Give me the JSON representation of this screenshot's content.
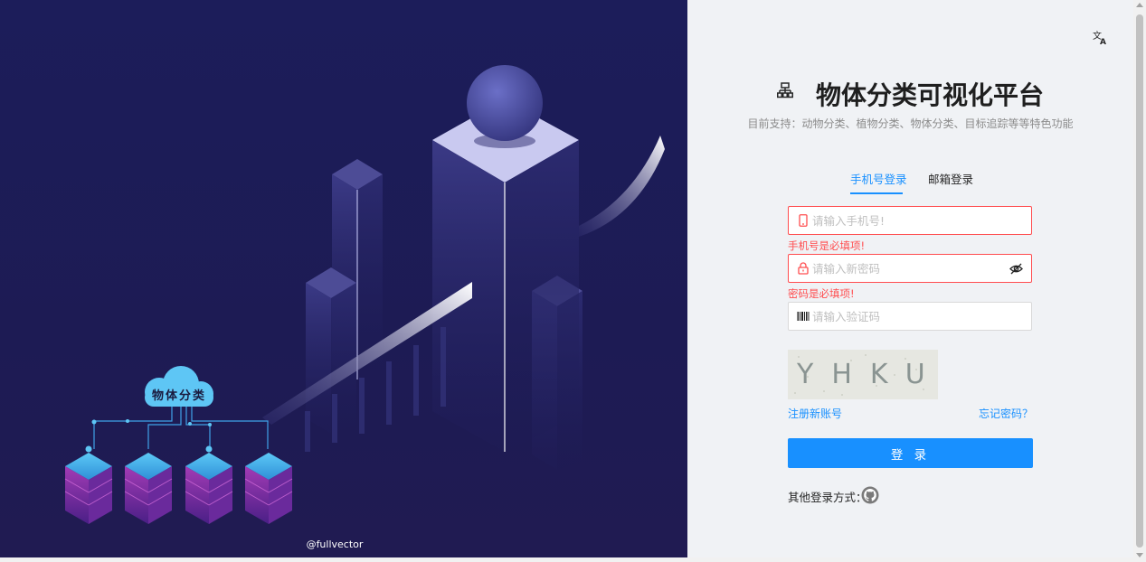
{
  "illustration": {
    "cloud_label": "物体分类",
    "credit": "@fullvector"
  },
  "header": {
    "translate_icon": "translate-icon",
    "brand_icon": "sitemap-icon",
    "title": "物体分类可视化平台",
    "subtitle": "目前支持：动物分类、植物分类、物体分类、目标追踪等等特色功能"
  },
  "tabs": [
    {
      "label": "手机号登录",
      "active": true
    },
    {
      "label": "邮箱登录",
      "active": false
    }
  ],
  "form": {
    "phone": {
      "placeholder": "请输入手机号!",
      "value": "",
      "error": "手机号是必填项!",
      "icon": "mobile-icon"
    },
    "password": {
      "placeholder": "请输入新密码",
      "value": "",
      "error": "密码是必填项!",
      "icon": "lock-icon",
      "toggle_icon": "eye-invisible-icon"
    },
    "captcha_input": {
      "placeholder": "请输入验证码",
      "value": "",
      "icon": "barcode-icon"
    },
    "captcha_image_text": "YHKU",
    "register_link": "注册新账号",
    "forgot_link": "忘记密码？",
    "login_button": "登 录",
    "other_login_label": "其他登录方式：",
    "other_login_icon": "github-icon"
  },
  "colors": {
    "primary": "#1890ff",
    "error": "#ff4d4f",
    "left_bg": "#1d1b54",
    "right_bg": "#f0f2f5"
  }
}
